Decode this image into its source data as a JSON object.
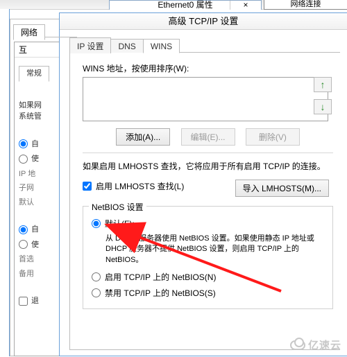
{
  "bg": {
    "ethernet_title": "Ethernet0 属性",
    "net_connections": "网络连接"
  },
  "outer": {
    "network_tab": "网络",
    "ipv4_title": "互",
    "general_tab": "常规",
    "blurb1": "如果网",
    "blurb2": "系统管",
    "auto_ip": "自",
    "use_ip": "使",
    "ip_label": "IP 地",
    "subnet_label": "子网",
    "default_label": "默认",
    "auto_dns": "自",
    "use_dns": "使",
    "pref_label": "首选",
    "alt_label": "备用",
    "exit_chk": "退"
  },
  "adv": {
    "title": "高级 TCP/IP 设置",
    "tabs": {
      "ip": "IP 设置",
      "dns": "DNS",
      "wins": "WINS"
    },
    "wins_label": "WINS 地址，按使用排序(W):",
    "btn_add": "添加(A)...",
    "btn_edit": "编辑(E)...",
    "btn_remove": "删除(V)",
    "lmhosts_note": "如果启用 LMHOSTS 查找，它将应用于所有启用 TCP/IP 的连接。",
    "lmhosts_chk": "启用 LMHOSTS 查找(L)",
    "import_btn": "导入 LMHOSTS(M)...",
    "netbios_group": "NetBIOS 设置",
    "opt_default": "默认(F):",
    "opt_default_desc": "从 DHCP 服务器使用 NetBIOS 设置。如果使用静态 IP 地址或 DHCP 服务器不提供 NetBIOS 设置，则启用 TCP/IP 上的 NetBIOS。",
    "opt_enable": "启用 TCP/IP 上的 NetBIOS(N)",
    "opt_disable": "禁用 TCP/IP 上的 NetBIOS(S)"
  },
  "watermark": "亿速云"
}
